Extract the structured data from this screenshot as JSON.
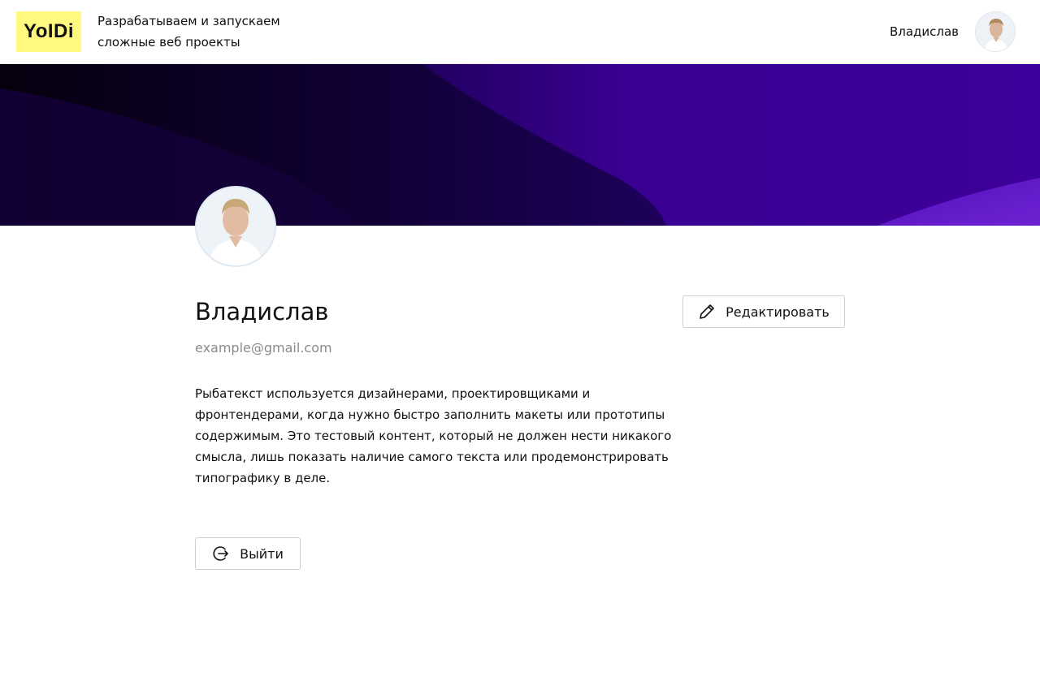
{
  "header": {
    "logo_text": "YoIDi",
    "tagline": "Разрабатываем и запускаем\nсложные веб проекты",
    "user_name": "Владислав",
    "logo_color": "#fff980"
  },
  "banner": {
    "colors": [
      "#0a0015",
      "#3a0090",
      "#6a1fd0"
    ]
  },
  "profile": {
    "name": "Владислав",
    "email": "example@gmail.com",
    "about": "Рыбатекст используется дизайнерами, проектировщиками и фронтендерами, когда нужно быстро заполнить макеты или прототипы содержимым. Это тестовый контент, который не должен нести никакого смысла, лишь показать наличие самого текста или продемонстрировать типографику в деле."
  },
  "actions": {
    "edit_label": "Редактировать",
    "edit_icon": "pencil-icon",
    "logout_label": "Выйти",
    "logout_icon": "logout-icon"
  }
}
